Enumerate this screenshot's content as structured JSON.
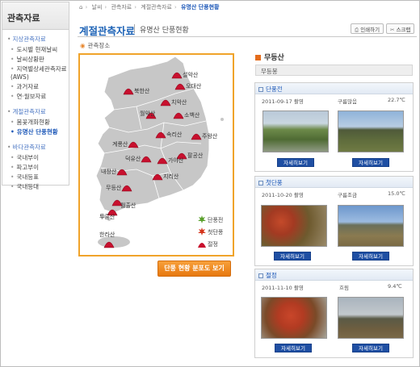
{
  "sidebar": {
    "title": "관측자료",
    "groups": [
      {
        "label": "지상관측자료",
        "items": [
          "도시별 현재날씨",
          "날씨상황판",
          "지역별상세관측자료(AWS)",
          "과거자료",
          "연·월보자료"
        ]
      },
      {
        "label": "계절관측자료",
        "items": [
          "봄꽃개화현황",
          "유명산 단풍현황"
        ]
      },
      {
        "label": "바다관측자료",
        "items": [
          "국내부이",
          "파고부이",
          "국내등표",
          "국내등대"
        ]
      }
    ],
    "active_item": "유명산 단풍현황"
  },
  "breadcrumb": {
    "items": [
      "홈",
      "날씨",
      "관측자료",
      "계절관측자료"
    ],
    "current": "유명산 단풍현황"
  },
  "header": {
    "title": "계절관측자료",
    "subtitle": "유명산 단풍현황"
  },
  "tools": {
    "print_label": "인쇄하기",
    "scrap_label": "스크랩"
  },
  "map": {
    "label": "관측장소",
    "mountains": [
      {
        "name": "설악산",
        "status": "peak"
      },
      {
        "name": "오대산",
        "status": "peak"
      },
      {
        "name": "북한산",
        "status": "peak"
      },
      {
        "name": "치악산",
        "status": "peak"
      },
      {
        "name": "월악산",
        "status": "peak"
      },
      {
        "name": "소백산",
        "status": "peak"
      },
      {
        "name": "계룡산",
        "status": "peak"
      },
      {
        "name": "속리산",
        "status": "peak"
      },
      {
        "name": "주왕산",
        "status": "peak"
      },
      {
        "name": "팔공산",
        "status": "peak"
      },
      {
        "name": "덕유산",
        "status": "peak"
      },
      {
        "name": "가야산",
        "status": "peak"
      },
      {
        "name": "내장산",
        "status": "peak"
      },
      {
        "name": "지리산",
        "status": "peak"
      },
      {
        "name": "무등산",
        "status": "peak"
      },
      {
        "name": "월출산",
        "status": "peak"
      },
      {
        "name": "두륜산",
        "status": "peak"
      },
      {
        "name": "한라산",
        "status": "peak"
      }
    ],
    "legend": {
      "first_foliage": "단풍전",
      "first_color": "첫단풍",
      "peak": "절정"
    },
    "distribution_button": "단풍 현황 분포도 보기"
  },
  "detail": {
    "mountain": "무등산",
    "place": "무등봉",
    "detail_button": "자세히보기",
    "cards": [
      {
        "stage": "단풍전",
        "date": "2011-09-17 촬영",
        "weather": "구름많음",
        "temp": "22.7℃"
      },
      {
        "stage": "첫단풍",
        "date": "2011-10-20 촬영",
        "weather": "구름조금",
        "temp": "15.0℃"
      },
      {
        "stage": "절정",
        "date": "2011-11-10 촬영",
        "weather": "흐림",
        "temp": "9.4℃"
      }
    ]
  },
  "colors": {
    "accent_blue": "#1e63b6",
    "accent_orange": "#f0a32a",
    "peak_red": "#c8102e",
    "button_blue": "#1f4fa3",
    "map_gray": "#c8c8c8"
  }
}
